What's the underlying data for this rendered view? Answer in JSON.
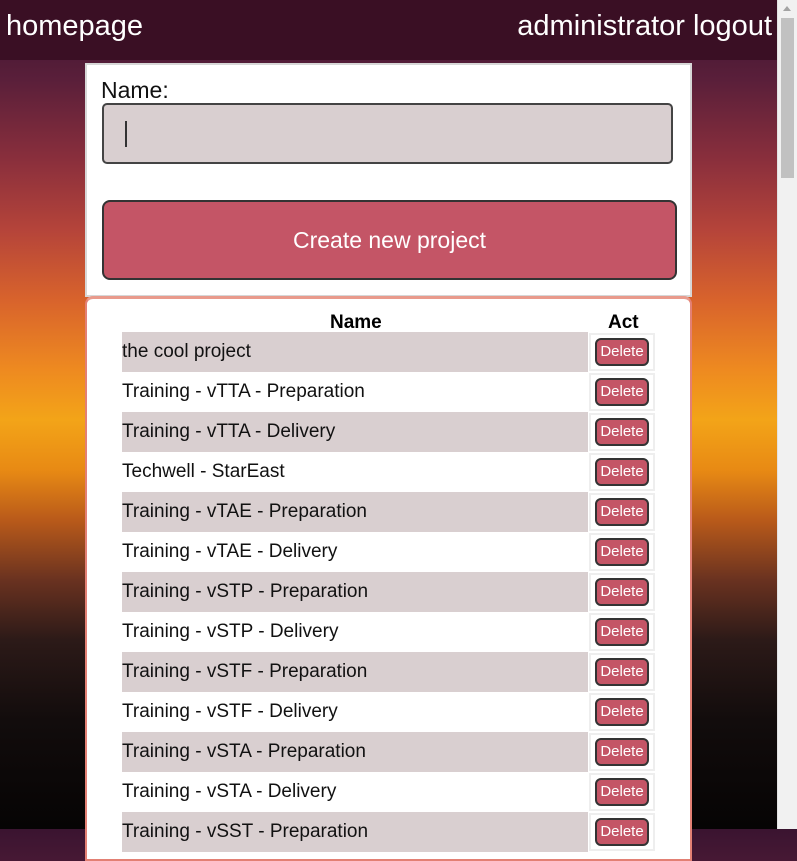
{
  "header": {
    "home_label": "homepage",
    "user_label": "administrator",
    "logout_label": "logout"
  },
  "form": {
    "name_label": "Name:",
    "name_value": "",
    "create_label": "Create new project"
  },
  "table": {
    "col_name": "Name",
    "col_act": "Act",
    "delete_label": "Delete",
    "rows": [
      {
        "name": "the cool project"
      },
      {
        "name": "Training - vTTA - Preparation"
      },
      {
        "name": "Training - vTTA - Delivery"
      },
      {
        "name": "Techwell - StarEast"
      },
      {
        "name": "Training - vTAE - Preparation"
      },
      {
        "name": "Training - vTAE - Delivery"
      },
      {
        "name": "Training - vSTP - Preparation"
      },
      {
        "name": "Training - vSTP - Delivery"
      },
      {
        "name": "Training - vSTF - Preparation"
      },
      {
        "name": "Training - vSTF - Delivery"
      },
      {
        "name": "Training - vSTA - Preparation"
      },
      {
        "name": "Training - vSTA - Delivery"
      },
      {
        "name": "Training - vSST - Preparation"
      }
    ]
  }
}
